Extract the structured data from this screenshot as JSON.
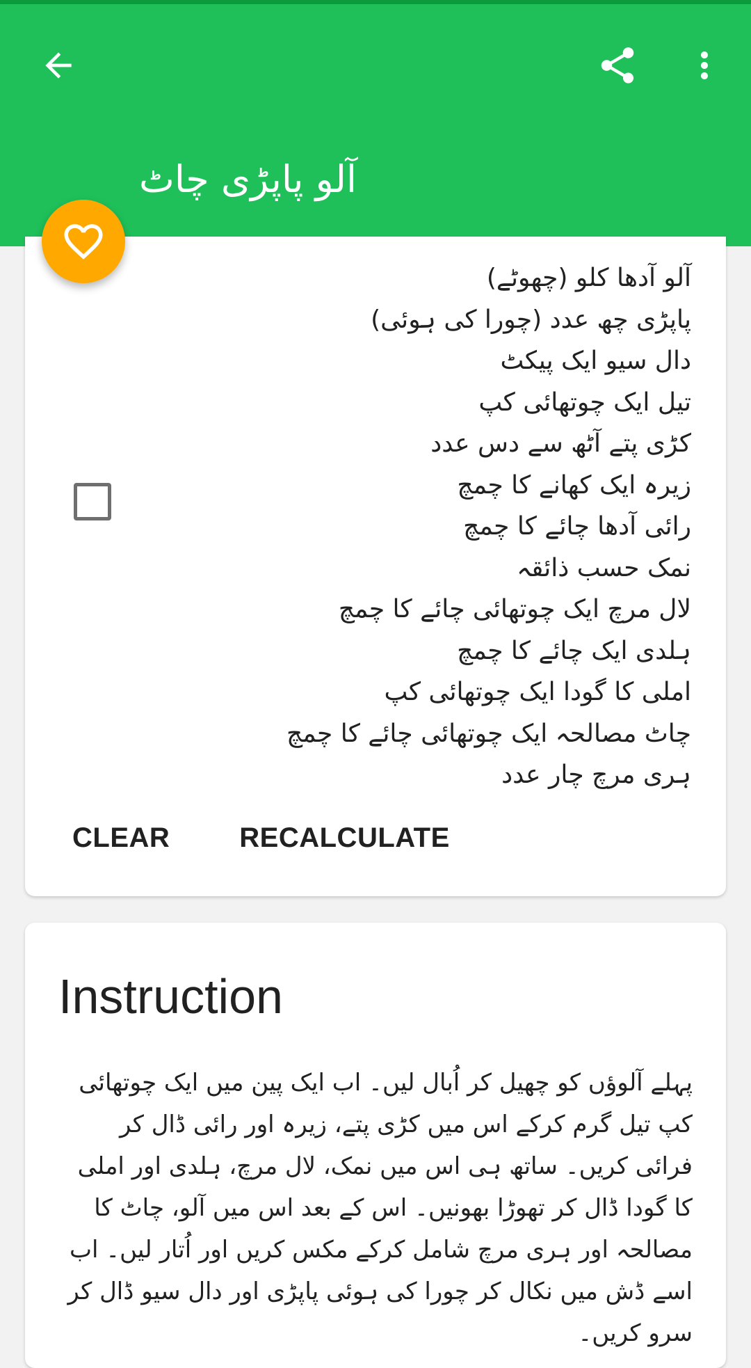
{
  "appbar": {
    "title": "آلو پاپڑی چاٹ",
    "back_icon": "arrow-back-icon",
    "share_icon": "share-icon",
    "more_icon": "more-vert-icon",
    "color": "#1fc05a"
  },
  "fab": {
    "icon": "heart-icon",
    "color": "#ffa800"
  },
  "ingredients": {
    "checked": false,
    "items": [
      "آلو آدھا کلو (چھوٹے)",
      "پاپڑی چھ عدد (چورا کی ہوئی)",
      "دال سیو ایک پیکٹ",
      "تیل ایک چوتھائی کپ",
      "کڑی پتے آٹھ سے دس عدد",
      "زیرہ ایک کھانے کا چمچ",
      "رائی آدھا چائے کا چمچ",
      "نمک حسب ذائقہ",
      "لال مرچ ایک چوتھائی چائے کا چمچ",
      "ہلدی ایک چائے کا چمچ",
      "املی کا گودا ایک چوتھائی کپ",
      "چاٹ مصالحہ ایک چوتھائی چائے کا چمچ",
      "ہری مرچ چار عدد"
    ],
    "clear_label": "CLEAR",
    "recalculate_label": "RECALCULATE"
  },
  "instruction": {
    "title": "Instruction",
    "text": "پہلے آلوؤں کو چھیل کر اُبال لیں۔ اب ایک پین میں ایک چوتھائی کپ تیل گرم کرکے اس میں کڑی پتے، زیرہ اور رائی ڈال کر فرائی کریں۔ ساتھ ہی اس میں نمک، لال مرچ، ہلدی اور املی کا گودا ڈال کر تھوڑا بھونیں۔ اس کے بعد اس میں آلو، چاٹ کا مصالحہ اور ہری مرچ شامل کرکے مکس کریں اور اُتار لیں۔ اب اسے ڈش میں نکال کر چورا کی ہوئی پاپڑی اور دال سیو ڈال کر سرو کریں۔"
  }
}
